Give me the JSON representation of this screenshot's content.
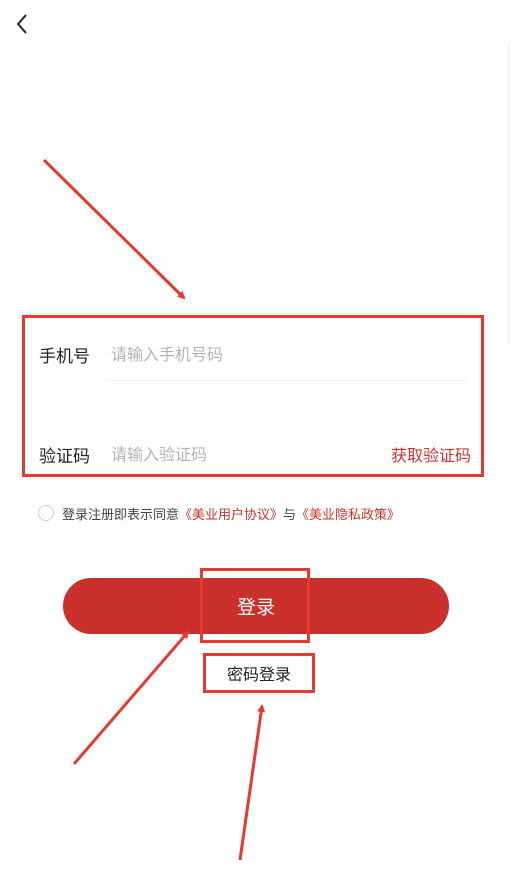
{
  "form": {
    "phone_label": "手机号",
    "phone_placeholder": "请输入手机号码",
    "code_label": "验证码",
    "code_placeholder": "请输入验证码",
    "get_code_label": "获取验证码"
  },
  "agreement": {
    "prefix": "登录注册即表示同意",
    "user_agreement": "《美业用户协议》",
    "conjunction": "与",
    "privacy_policy": "《美业隐私政策》"
  },
  "actions": {
    "login_label": "登录",
    "password_login_label": "密码登录"
  },
  "colors": {
    "accent": "#c9302c",
    "annotation": "#e53a2e",
    "link": "#c9352b"
  },
  "icons": {
    "back": "chevron-left-icon"
  }
}
